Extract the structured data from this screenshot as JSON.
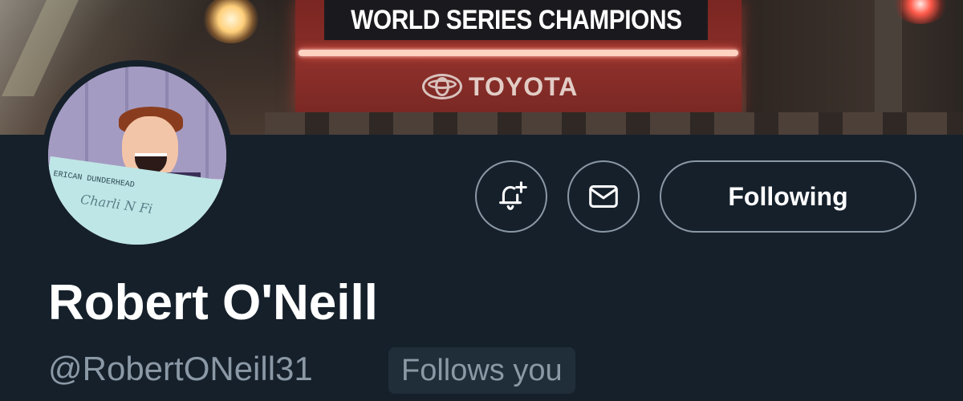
{
  "banner": {
    "sign_title": "WORLD SERIES CHAMPIONS",
    "sponsor": "TOYOTA",
    "sponsor_logo_icon": "toyota-logo-icon"
  },
  "avatar": {
    "check_line1": "ERICAN DUNDERHEAD",
    "check_line2": "Charli N Fi"
  },
  "actions": {
    "notify_icon": "bell-plus-icon",
    "message_icon": "envelope-icon",
    "follow_label": "Following"
  },
  "profile": {
    "display_name": "Robert O'Neill",
    "handle": "@RobertONeill31",
    "follows_you": "Follows you"
  },
  "colors": {
    "background": "#15202b",
    "secondary_text": "#8b98a5",
    "border": "#8b98a5",
    "badge_bg": "#202e3a"
  }
}
